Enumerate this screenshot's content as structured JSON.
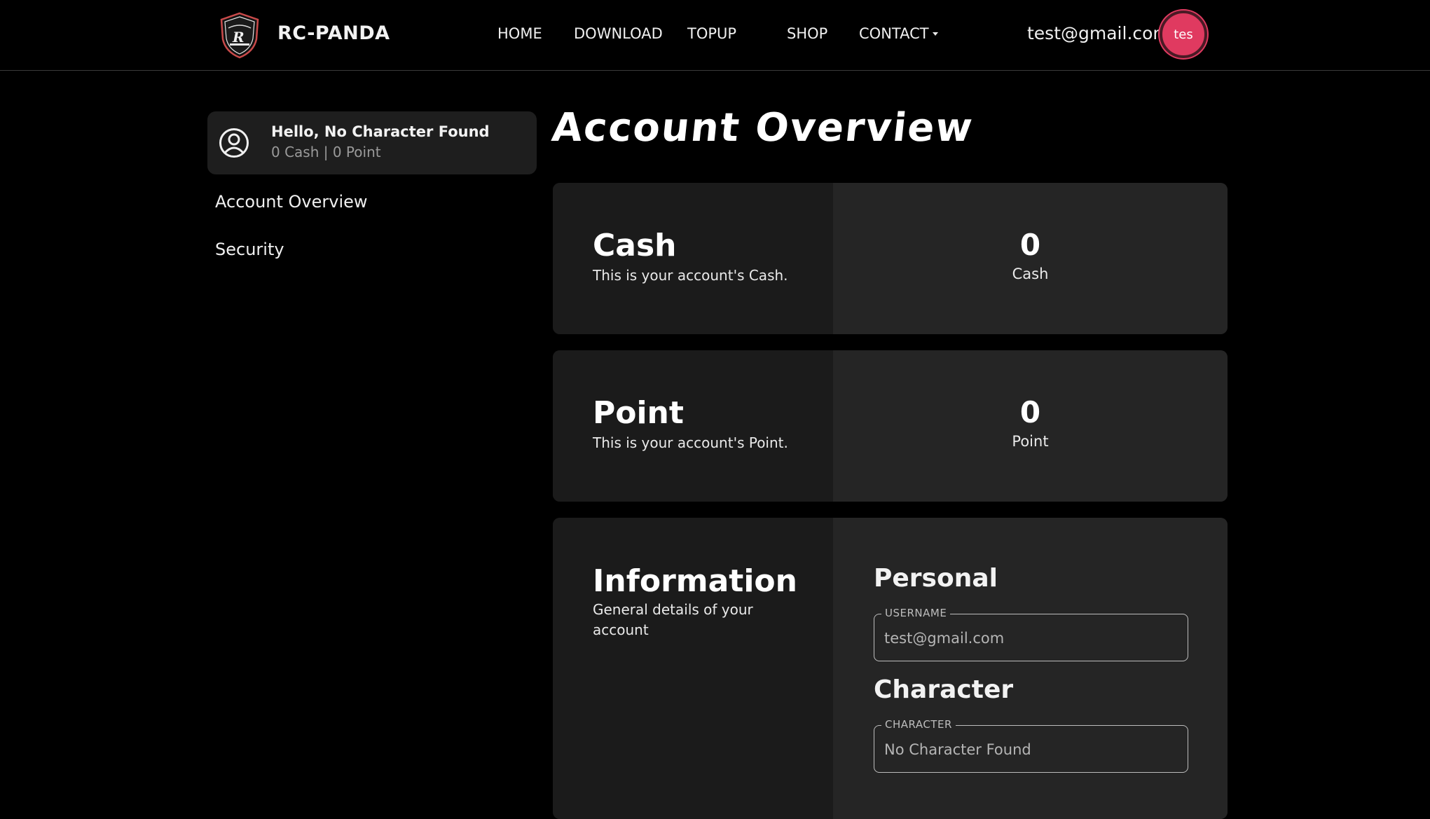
{
  "header": {
    "brand": "RC-PANDA",
    "nav": [
      "HOME",
      "DOWNLOAD",
      "TOPUP",
      "SHOP",
      "CONTACT"
    ],
    "user_email": "test@gmail.com",
    "avatar_initials": "tes"
  },
  "sidebar": {
    "greeting": "Hello, No Character Found",
    "balance": "0 Cash | 0 Point",
    "items": [
      "Account Overview",
      "Security"
    ]
  },
  "main": {
    "title": "Account Overview",
    "cash": {
      "title": "Cash",
      "description": "This is your account's Cash.",
      "value": "0",
      "unit": "Cash"
    },
    "point": {
      "title": "Point",
      "description": "This is your account's Point.",
      "value": "0",
      "unit": "Point"
    },
    "information": {
      "title": "Information",
      "description": "General details of your account",
      "personal_heading": "Personal",
      "username_label": "USERNAME",
      "username_value": "test@gmail.com",
      "character_heading": "Character",
      "character_label": "CHARACTER",
      "character_value": "No Character Found"
    }
  },
  "colors": {
    "background": "#000000",
    "card_left": "#1b1b1b",
    "card_right": "#252525",
    "avatar": "#e03a60"
  }
}
